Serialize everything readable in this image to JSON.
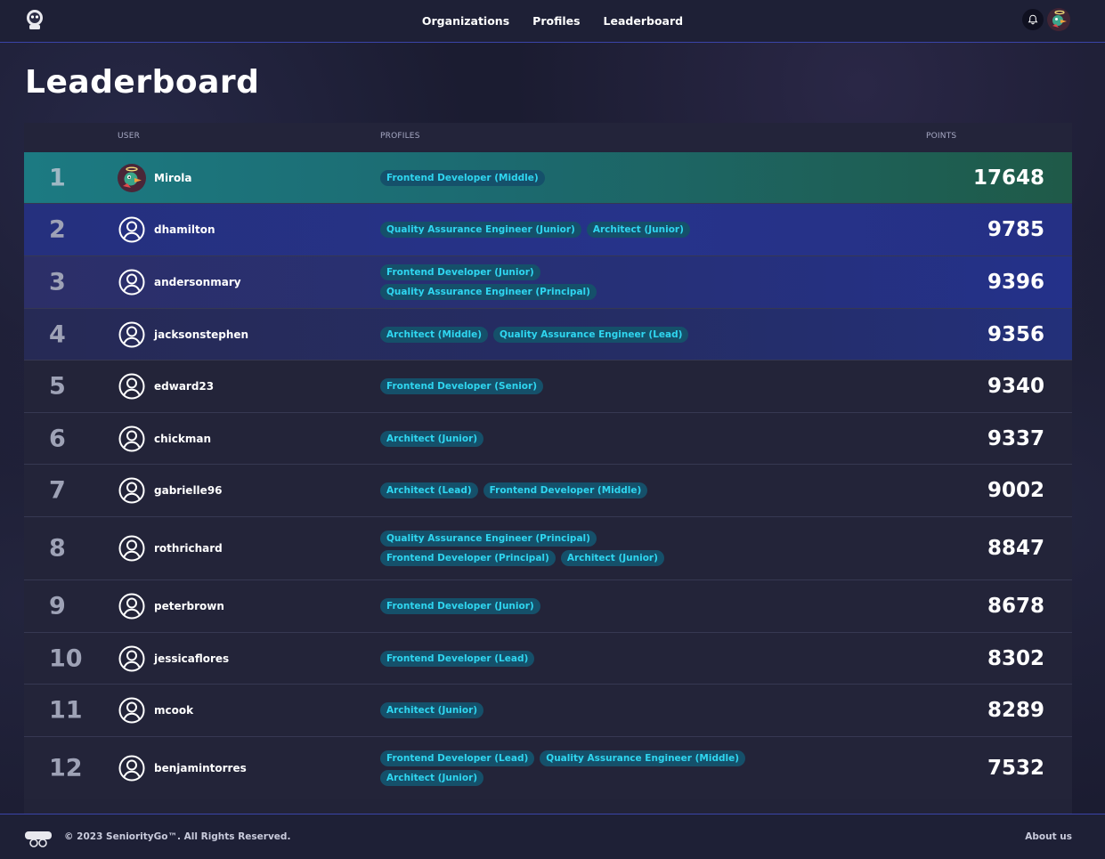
{
  "nav": {
    "links": [
      "Organizations",
      "Profiles",
      "Leaderboard"
    ]
  },
  "page": {
    "title": "Leaderboard"
  },
  "table": {
    "headers": {
      "user": "USER",
      "profiles": "PROFILES",
      "points": "POINTS"
    },
    "rows": [
      {
        "rank": "1",
        "user": "Mirola",
        "avatar": "custom-avatar",
        "profiles": [
          "Frontend Developer (Middle)"
        ],
        "points": "17648"
      },
      {
        "rank": "2",
        "user": "dhamilton",
        "avatar": "user-circle-icon",
        "profiles": [
          "Quality Assurance Engineer (Junior)",
          "Architect (Junior)"
        ],
        "points": "9785"
      },
      {
        "rank": "3",
        "user": "andersonmary",
        "avatar": "user-circle-icon",
        "profiles": [
          "Frontend Developer (Junior)",
          "Quality Assurance Engineer (Principal)"
        ],
        "points": "9396"
      },
      {
        "rank": "4",
        "user": "jacksonstephen",
        "avatar": "user-circle-icon",
        "profiles": [
          "Architect (Middle)",
          "Quality Assurance Engineer (Lead)"
        ],
        "points": "9356"
      },
      {
        "rank": "5",
        "user": "edward23",
        "avatar": "user-circle-icon",
        "profiles": [
          "Frontend Developer (Senior)"
        ],
        "points": "9340"
      },
      {
        "rank": "6",
        "user": "chickman",
        "avatar": "user-circle-icon",
        "profiles": [
          "Architect (Junior)"
        ],
        "points": "9337"
      },
      {
        "rank": "7",
        "user": "gabrielle96",
        "avatar": "user-circle-icon",
        "profiles": [
          "Architect (Lead)",
          "Frontend Developer (Middle)"
        ],
        "points": "9002"
      },
      {
        "rank": "8",
        "user": "rothrichard",
        "avatar": "user-circle-icon",
        "profiles": [
          "Quality Assurance Engineer (Principal)",
          "Frontend Developer (Principal)",
          "Architect (Junior)"
        ],
        "points": "8847"
      },
      {
        "rank": "9",
        "user": "peterbrown",
        "avatar": "user-circle-icon",
        "profiles": [
          "Frontend Developer (Junior)"
        ],
        "points": "8678"
      },
      {
        "rank": "10",
        "user": "jessicaflores",
        "avatar": "user-circle-icon",
        "profiles": [
          "Frontend Developer (Lead)"
        ],
        "points": "8302"
      },
      {
        "rank": "11",
        "user": "mcook",
        "avatar": "user-circle-icon",
        "profiles": [
          "Architect (Junior)"
        ],
        "points": "8289"
      },
      {
        "rank": "12",
        "user": "benjamintorres",
        "avatar": "user-circle-icon",
        "profiles": [
          "Frontend Developer (Lead)",
          "Quality Assurance Engineer (Middle)",
          "Architect (Junior)"
        ],
        "points": "7532"
      }
    ]
  },
  "footer": {
    "copyright": "© 2023 SeniorityGo™. All Rights Reserved.",
    "about": "About us"
  },
  "colors": {
    "accent_border": "#3a44a8",
    "badge_bg": "#15506a",
    "badge_text": "#2fd6f0",
    "row1_gradient": [
      "#1c7c7a",
      "#1f5f4a"
    ],
    "row_blue_gradient": [
      "#26327f",
      "#232439"
    ]
  }
}
